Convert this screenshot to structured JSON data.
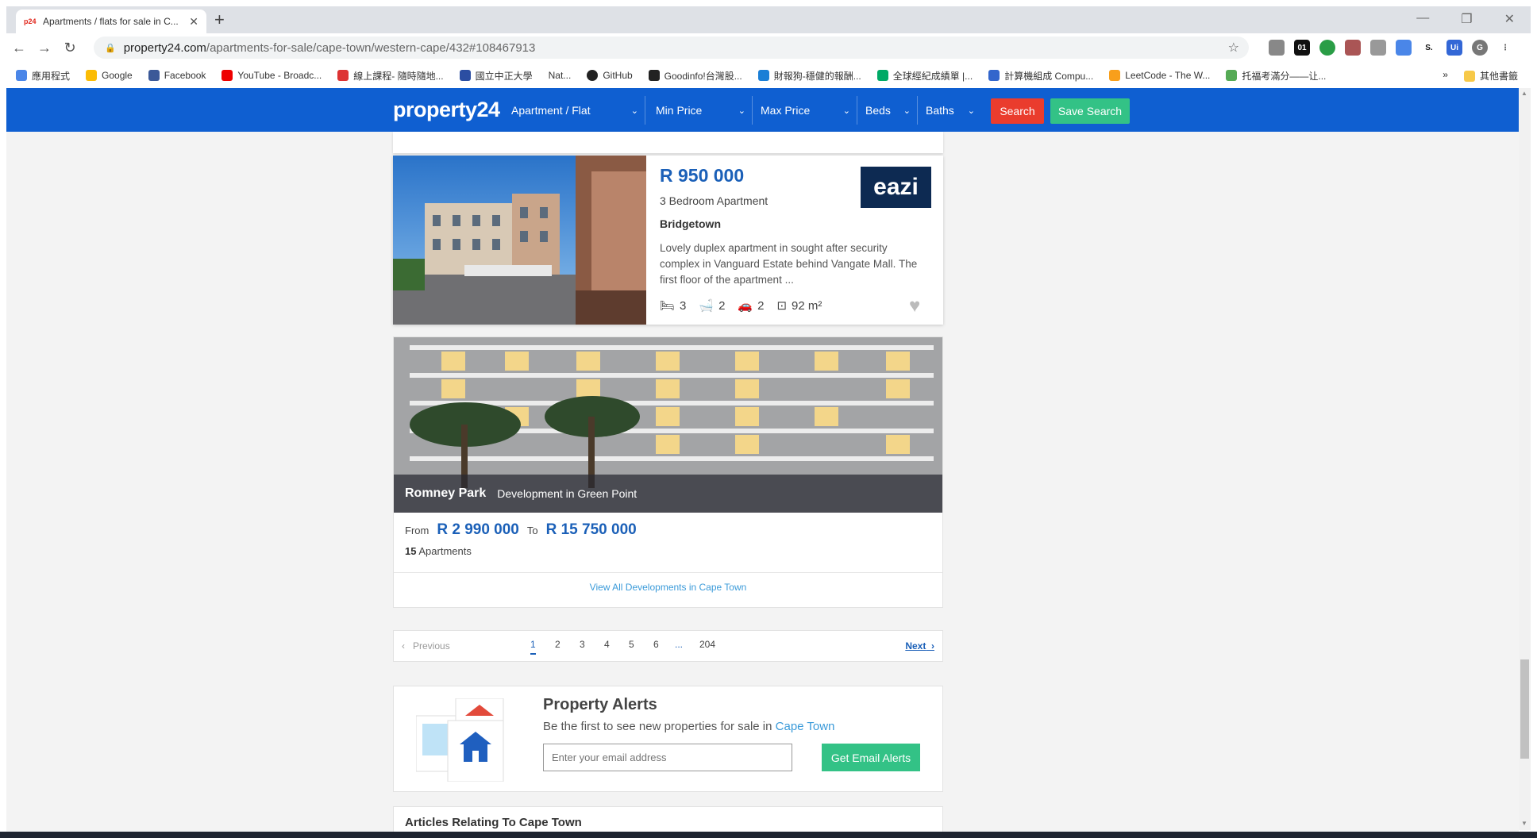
{
  "browser": {
    "tab_title": "Apartments / flats for sale in C...",
    "tab_favicon": "p24",
    "url_host": "property24.com",
    "url_path": "/apartments-for-sale/cape-town/western-cape/432#108467913",
    "bookmarks": [
      "應用程式",
      "Google",
      "Facebook",
      "YouTube - Broadc...",
      "線上課程- 隨時隨地...",
      "國立中正大學",
      "Nat...",
      "GitHub",
      "Goodinfo!台灣股...",
      "財報狗-穩健的報酬...",
      "全球經紀成績單 |...",
      "計算機組成 Compu...",
      "LeetCode - The W...",
      "托福考滿分——让..."
    ],
    "bookmarks_more": "»",
    "other_bookmarks": "其他書籤"
  },
  "nav": {
    "logo": "property24",
    "type_label": "Apartment / Flat",
    "min_price_label": "Min Price",
    "max_price_label": "Max Price",
    "beds_label": "Beds",
    "baths_label": "Baths",
    "search_label": "Search",
    "save_search_label": "Save Search"
  },
  "listing": {
    "price": "R 950 000",
    "type": "3 Bedroom Apartment",
    "suburb": "Bridgetown",
    "description": "Lovely duplex apartment in sought after security complex in Vanguard Estate behind Vangate Mall. The first floor of the apartment ...",
    "agency_logo_text": "eazi",
    "beds": "3",
    "baths": "2",
    "parking": "2",
    "size": "92 m²"
  },
  "development": {
    "name": "Romney Park",
    "subtitle": "Development in Green Point",
    "from_label": "From",
    "from_price": "R 2 990 000",
    "to_label": "To",
    "to_price": "R 15 750 000",
    "count_number": "15",
    "count_label": "Apartments",
    "view_all": "View All Developments in Cape Town"
  },
  "pagination": {
    "previous": "Previous",
    "pages": [
      "1",
      "2",
      "3",
      "4",
      "5",
      "6",
      "...",
      "204"
    ],
    "active_page": "1",
    "next": "Next"
  },
  "alerts": {
    "title": "Property Alerts",
    "subtitle_prefix": "Be the first to see new properties for sale in ",
    "subtitle_city": "Cape Town",
    "email_placeholder": "Enter your email address",
    "button": "Get Email Alerts"
  },
  "articles": {
    "title": "Articles Relating To Cape Town"
  },
  "colors": {
    "nav_blue": "#0f5fd1",
    "price_blue": "#1b60b8",
    "search_red": "#ea3c2d",
    "save_green": "#33c286",
    "link_blue": "#3a9ad9"
  }
}
